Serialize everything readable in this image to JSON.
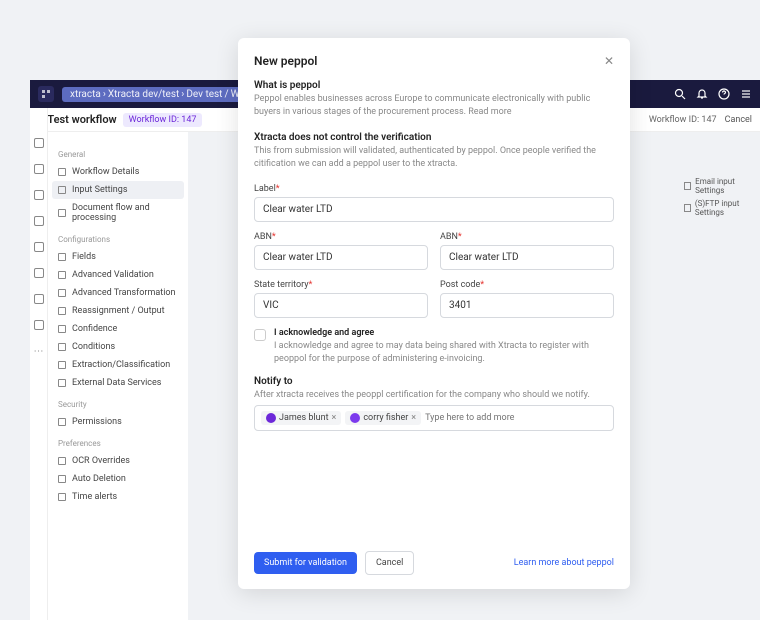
{
  "topbar": {
    "crumbs": [
      "xtracta",
      "Xtracta dev/test",
      "Dev test",
      "Workflows"
    ]
  },
  "header": {
    "title": "Test workflow",
    "badge": "Workflow ID: 147",
    "wfid": "Workflow ID: 147",
    "cancel": "Cancel"
  },
  "sidebar": {
    "sections": {
      "general": "General",
      "configurations": "Configurations",
      "security": "Security",
      "preferences": "Preferences"
    },
    "items": {
      "workflowDetails": "Workflow Details",
      "inputSettings": "Input Settings",
      "documentFlow": "Document flow and processing",
      "fields": "Fields",
      "advancedValidation": "Advanced Validation",
      "advancedTransformation": "Advanced Transformation",
      "reassignment": "Reassignment / Output",
      "confidence": "Confidence",
      "conditions": "Conditions",
      "extraction": "Extraction/Classification",
      "externalData": "External Data Services",
      "permissions": "Permissions",
      "ocrOverrides": "OCR Overrides",
      "autoDeletion": "Auto Deletion",
      "timeAlerts": "Time alerts"
    }
  },
  "rightPanel": {
    "email": "Email input Settings",
    "sftp": "(S)FTP input Settings"
  },
  "modal": {
    "title": "New peppol",
    "whatIs": {
      "title": "What is peppol",
      "text": "Peppol enables businesses across Europe to communicate electronically with public buyers in various stages of the procurement process. Read more"
    },
    "verification": {
      "title": "Xtracta does not control the verification",
      "text": "This from submission will validated, authenticated by peppol. Once people verified the citification we can add a peppol user to the xtracta."
    },
    "form": {
      "labelLabel": "Label",
      "labelValue": "Clear water LTD",
      "abn1Label": "ABN",
      "abn1Value": "Clear water LTD",
      "abn2Label": "ABN",
      "abn2Value": "Clear water LTD",
      "stateLabel": "State territory",
      "stateValue": "VIC",
      "postLabel": "Post code",
      "postValue": "3401"
    },
    "acknowledge": {
      "label": "I acknowledge and agree",
      "desc": "I acknowledge and agree to may data being shared with Xtracta to register with peoppol for the purpose of administering e-invoicing."
    },
    "notify": {
      "label": "Notify to",
      "desc": "After xtracta receives the peoppl certification for the company who should we notify.",
      "chip1": "James blunt",
      "chip2": "corry fisher",
      "placeholder": "Type here to add more"
    },
    "footer": {
      "submit": "Submit for validation",
      "cancel": "Cancel",
      "learn": "Learn more about peppol"
    }
  }
}
